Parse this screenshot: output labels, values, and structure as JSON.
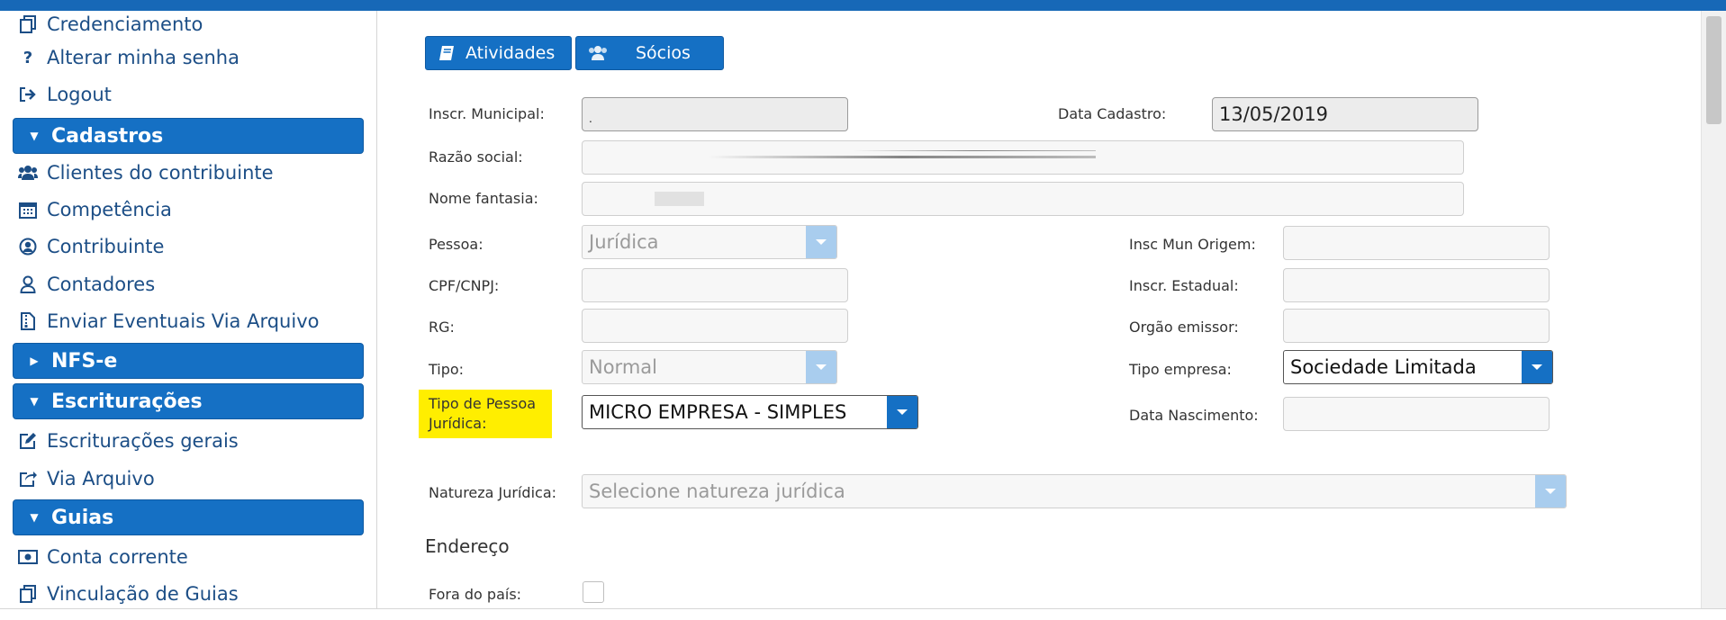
{
  "sidebar": {
    "links_top": [
      {
        "label": "Credenciamento",
        "icon": "copy-icon"
      },
      {
        "label": "Alterar minha senha",
        "icon": "question-icon"
      },
      {
        "label": "Logout",
        "icon": "logout-icon"
      }
    ],
    "sections": {
      "cadastros": {
        "label": "Cadastros",
        "expanded": true
      },
      "nfse": {
        "label": "NFS-e",
        "expanded": false
      },
      "escrituracoes": {
        "label": "Escriturações",
        "expanded": true
      },
      "guias": {
        "label": "Guias",
        "expanded": true
      }
    },
    "cadastros_items": [
      {
        "label": "Clientes do contribuinte",
        "icon": "users-icon"
      },
      {
        "label": "Competência",
        "icon": "calendar-icon"
      },
      {
        "label": "Contribuinte",
        "icon": "user-circle-icon"
      },
      {
        "label": "Contadores",
        "icon": "user-icon"
      },
      {
        "label": "Enviar Eventuais Via Arquivo",
        "icon": "file-archive-icon"
      }
    ],
    "escrituracoes_items": [
      {
        "label": "Escriturações gerais",
        "icon": "edit-icon"
      },
      {
        "label": "Via Arquivo",
        "icon": "share-icon"
      }
    ],
    "guias_items": [
      {
        "label": "Conta corrente",
        "icon": "money-icon"
      },
      {
        "label": "Vinculação de Guias",
        "icon": "copy-icon"
      }
    ]
  },
  "tabs": {
    "atividades": "Atividades",
    "socios": "Sócios"
  },
  "form": {
    "inscr_municipal": {
      "label": "Inscr. Municipal:",
      "value": "."
    },
    "data_cadastro": {
      "label": "Data Cadastro:",
      "value": "13/05/2019"
    },
    "razao_social": {
      "label": "Razão social:",
      "value": ""
    },
    "nome_fantasia": {
      "label": "Nome fantasia:",
      "value": ""
    },
    "pessoa": {
      "label": "Pessoa:",
      "value": "Jurídica"
    },
    "insc_mun_origem": {
      "label": "Insc Mun Origem:",
      "value": ""
    },
    "cpf_cnpj": {
      "label": "CPF/CNPJ:",
      "value": ""
    },
    "inscr_estadual": {
      "label": "Inscr. Estadual:",
      "value": ""
    },
    "rg": {
      "label": "RG:",
      "value": ""
    },
    "orgao_emissor": {
      "label": "Orgão emissor:",
      "value": ""
    },
    "tipo": {
      "label": "Tipo:",
      "value": "Normal"
    },
    "tipo_empresa": {
      "label": "Tipo empresa:",
      "value": "Sociedade Limitada"
    },
    "tipo_pessoa_juridica": {
      "label_line1": "Tipo de Pessoa",
      "label_line2": "Jurídica:",
      "value": "MICRO EMPRESA - SIMPLES"
    },
    "data_nascimento": {
      "label": "Data Nascimento:",
      "value": ""
    },
    "natureza_juridica": {
      "label": "Natureza Jurídica:",
      "placeholder": "Selecione natureza jurídica"
    },
    "endereco_heading": "Endereço",
    "fora_do_pais": {
      "label": "Fora do país:",
      "checked": false
    }
  },
  "colors": {
    "primary": "#1570c4",
    "highlight": "#ffee00"
  }
}
